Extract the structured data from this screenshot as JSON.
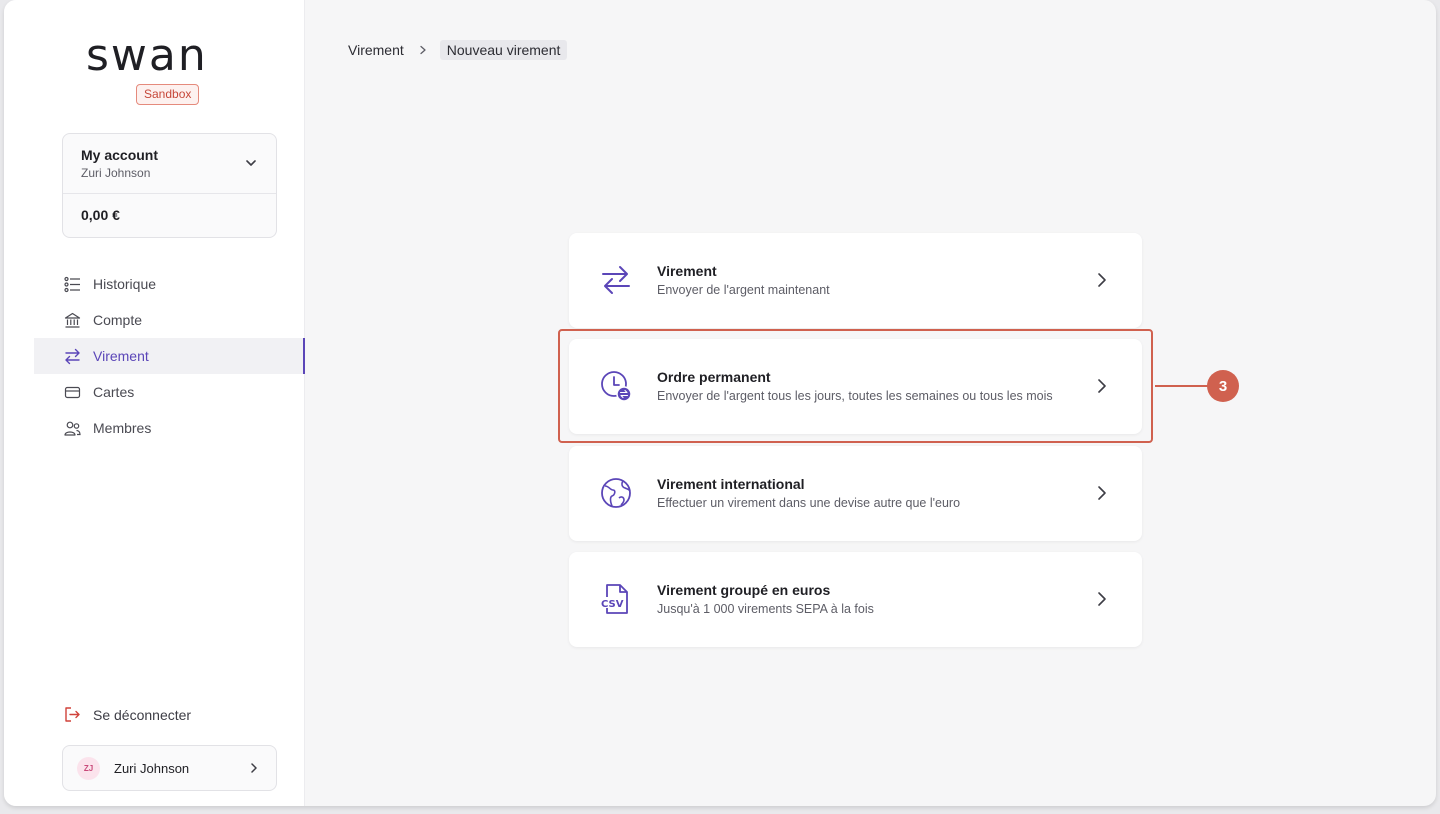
{
  "sidebar": {
    "logo": "swan",
    "environment_badge": "Sandbox",
    "account": {
      "title": "My account",
      "holder": "Zuri Johnson",
      "balance": "0,00 €"
    },
    "nav": [
      {
        "label": "Historique",
        "icon": "list-icon"
      },
      {
        "label": "Compte",
        "icon": "bank-icon"
      },
      {
        "label": "Virement",
        "icon": "transfer-icon",
        "active": true
      },
      {
        "label": "Cartes",
        "icon": "card-icon"
      },
      {
        "label": "Membres",
        "icon": "members-icon"
      }
    ],
    "logout_label": "Se déconnecter",
    "user": {
      "initials": "ZJ",
      "name": "Zuri Johnson"
    }
  },
  "breadcrumb": {
    "parent": "Virement",
    "current": "Nouveau virement"
  },
  "options": [
    {
      "title": "Virement",
      "subtitle": "Envoyer de l'argent maintenant",
      "icon": "transfer-arrows-icon"
    },
    {
      "title": "Ordre permanent",
      "subtitle": "Envoyer de l'argent tous les jours, toutes les semaines ou tous les mois",
      "icon": "clock-recurring-icon"
    },
    {
      "title": "Virement international",
      "subtitle": "Effectuer un virement dans une devise autre que l'euro",
      "icon": "globe-icon"
    },
    {
      "title": "Virement groupé en euros",
      "subtitle": "Jusqu'à 1 000 virements SEPA à la fois",
      "icon": "csv-file-icon"
    }
  ],
  "callout": {
    "number": "3",
    "color": "#d0614f"
  },
  "colors": {
    "accent": "#5b46b8",
    "highlight": "#d0614f"
  }
}
